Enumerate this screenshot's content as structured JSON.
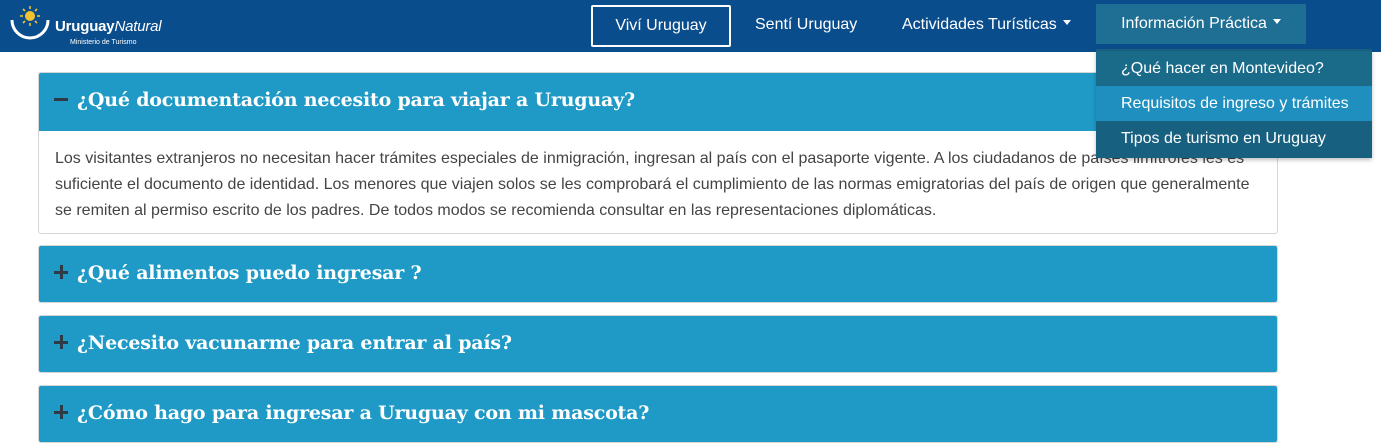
{
  "brand": {
    "name_bold": "Uruguay",
    "name_italic": "Natural",
    "subtitle": "Ministerio de Turismo",
    "logo_icon": "sun-icon"
  },
  "nav": {
    "items": [
      {
        "label": "Viví Uruguay"
      },
      {
        "label": "Sentí Uruguay"
      },
      {
        "label": "Actividades Turísticas"
      },
      {
        "label": "Información Práctica"
      }
    ]
  },
  "dropdown": {
    "items": [
      {
        "label": "¿Qué hacer en Montevideo?"
      },
      {
        "label": "Requisitos de ingreso y trámites"
      },
      {
        "label": "Tipos de turismo en Uruguay"
      }
    ]
  },
  "faq": [
    {
      "question": "¿Qué documentación necesito para viajar a Uruguay?",
      "answer": "Los visitantes extranjeros no necesitan hacer trámites especiales de inmigración, ingresan al país con el pasaporte vigente. A los ciudadanos de países limítrofes les es suficiente el documento de identidad. Los menores que viajen solos se les comprobará el cumplimiento de las normas emigratorias del país de origen que generalmente se remiten al permiso escrito de los padres. De todos modos se recomienda consultar en las representaciones diplomáticas.",
      "expanded": true
    },
    {
      "question": "¿Qué alimentos puedo ingresar ?",
      "expanded": false
    },
    {
      "question": "¿Necesito vacunarme para entrar al país?",
      "expanded": false
    },
    {
      "question": "¿Cómo hago para ingresar a Uruguay con mi mascota?",
      "expanded": false
    }
  ],
  "colors": {
    "navbar": "#0a4d8c",
    "accordion_header": "#1f9ac6",
    "dropdown": "#17607f",
    "dropdown_active": "#1f8fbf"
  }
}
